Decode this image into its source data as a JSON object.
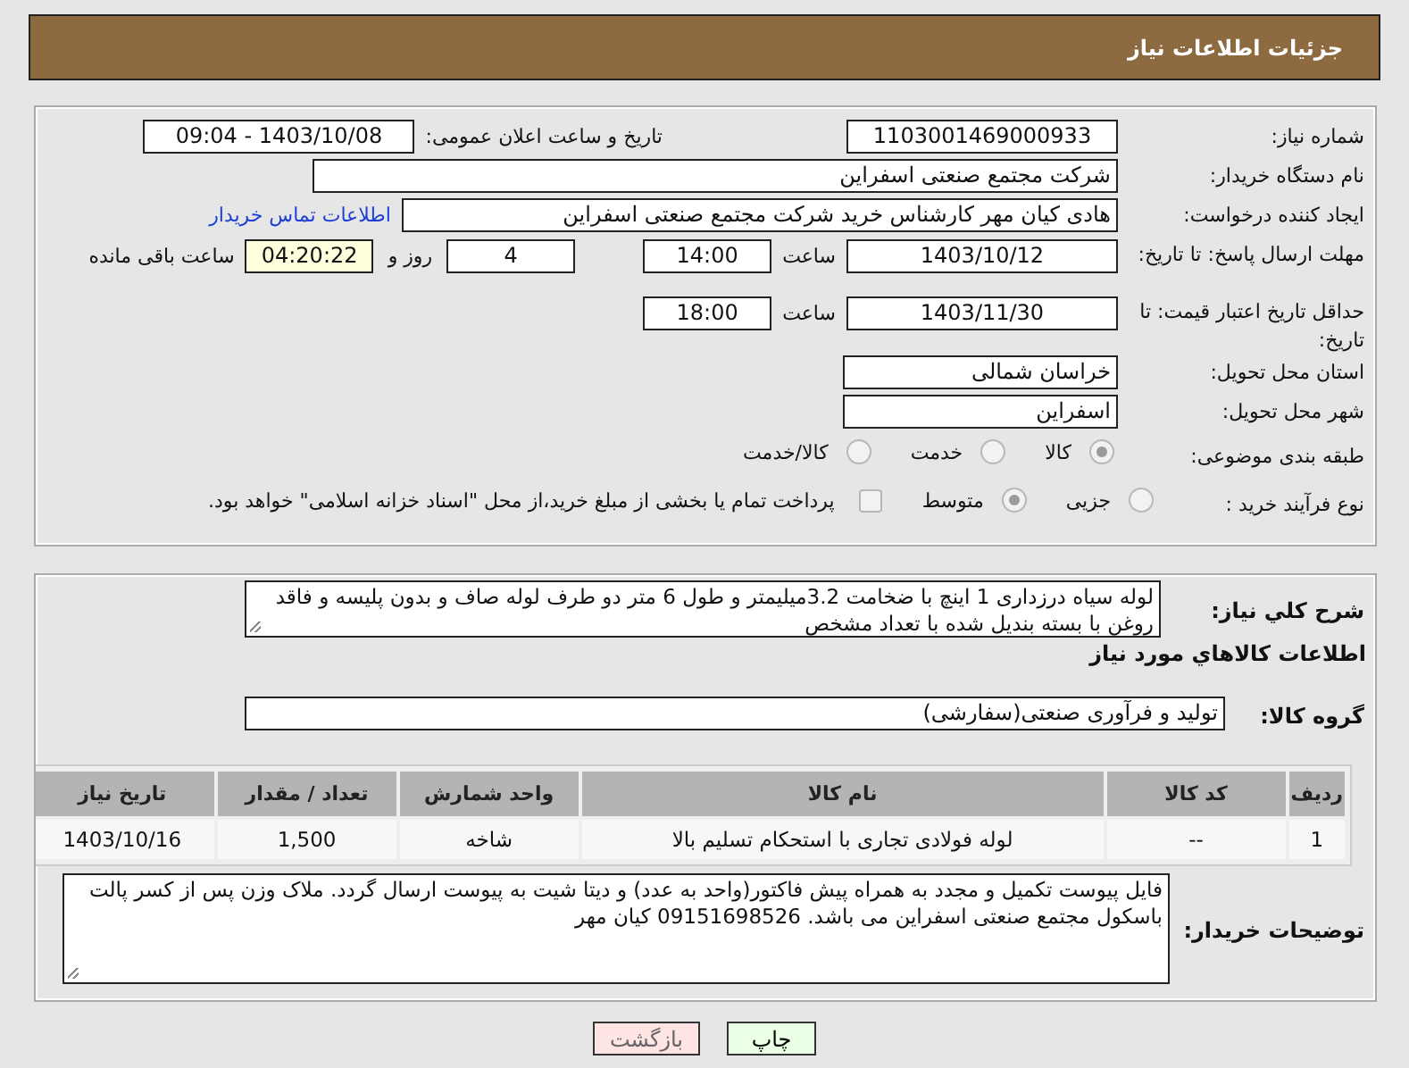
{
  "header": {
    "title": "جزئیات اطلاعات نیاز"
  },
  "details": [
    {
      "label": "شماره نیاز:",
      "items": [
        {
          "kind": "field",
          "value": "1103001469000933"
        },
        {
          "kind": "caption",
          "text": "تاریخ و ساعت اعلان عمومی:"
        },
        {
          "kind": "field",
          "value": "1403/10/08 - 09:04"
        }
      ]
    },
    {
      "label": "نام دستگاه خریدار:",
      "items": [
        {
          "kind": "wide_field",
          "value": "شرکت مجتمع صنعتی اسفراین"
        }
      ]
    },
    {
      "label": "ایجاد کننده درخواست:",
      "items": [
        {
          "kind": "wide_field",
          "value": "هادی کیان مهر کارشناس خرید شرکت مجتمع صنعتی اسفراین"
        },
        {
          "kind": "link",
          "text": "اطلاعات تماس خریدار"
        }
      ]
    },
    {
      "label": "مهلت ارسال پاسخ: تا تاریخ:",
      "items": [
        {
          "kind": "field",
          "value": "1403/10/12"
        },
        {
          "kind": "caption",
          "text": "ساعت"
        },
        {
          "kind": "short_field",
          "value": "14:00"
        },
        {
          "kind": "short_field",
          "value": "4"
        },
        {
          "kind": "caption",
          "text": "روز و"
        },
        {
          "kind": "timer",
          "value": "04:20:22"
        },
        {
          "kind": "caption",
          "text": "ساعت باقی مانده"
        }
      ]
    },
    {
      "label": "حداقل تاریخ اعتبار قیمت: تا تاریخ:",
      "items": [
        {
          "kind": "field",
          "value": "1403/11/30"
        },
        {
          "kind": "caption",
          "text": "ساعت"
        },
        {
          "kind": "short_field",
          "value": "18:00"
        }
      ]
    },
    {
      "label": "استان محل تحویل:",
      "items": [
        {
          "kind": "field",
          "value": "خراسان شمالی"
        }
      ]
    },
    {
      "label": "شهر محل تحویل:",
      "items": [
        {
          "kind": "field",
          "value": "اسفراین"
        }
      ]
    },
    {
      "label": "طبقه بندی موضوعی:",
      "items": [
        {
          "kind": "radio",
          "text": "کالا",
          "selected": true
        },
        {
          "kind": "radio",
          "text": "خدمت",
          "selected": false
        },
        {
          "kind": "radio",
          "text": "کالا/خدمت",
          "selected": false
        }
      ]
    },
    {
      "label": "نوع فرآیند خرید :",
      "items": [
        {
          "kind": "radio",
          "text": "جزیی",
          "selected": false
        },
        {
          "kind": "radio",
          "text": "متوسط",
          "selected": true
        },
        {
          "kind": "checkbox",
          "text": "پرداخت تمام یا بخشی از مبلغ خرید،از محل \"اسناد خزانه اسلامی\" خواهد بود.",
          "checked": false
        }
      ]
    }
  ],
  "description": {
    "label": "شرح کلي نیاز:",
    "value": "لوله سیاه درزداری 1 اینچ با ضخامت 3.2میلیمتر و طول 6 متر دو طرف لوله صاف و بدون پلیسه و فاقد روغن با بسته بندیل شده با تعداد مشخص"
  },
  "goods_heading": "اطلاعات کالاهاي مورد نیاز",
  "goods_group": {
    "label": "گروه کالا:",
    "value": "تولید و فرآوری صنعتی(سفارشی)"
  },
  "table": {
    "columns": [
      "ردیف",
      "کد کالا",
      "نام کالا",
      "واحد شمارش",
      "تعداد / مقدار",
      "تاریخ نیاز"
    ],
    "rows": [
      [
        "1",
        "--",
        "لوله فولادی تجاری با استحکام تسلیم بالا",
        "شاخه",
        "1,500",
        "1403/10/16"
      ]
    ]
  },
  "buyer_notes": {
    "label": "توضیحات خریدار:",
    "value": "فایل پیوست تکمیل و مجدد به همراه پیش فاکتور(واحد به عدد) و دیتا شیت به پیوست ارسال گردد. ملاک وزن پس از کسر پالت باسکول مجتمع صنعتی اسفراین می باشد. 09151698526 کیان مهر"
  },
  "buttons": [
    {
      "label": "چاپ",
      "kind": "print"
    },
    {
      "label": "بازگشت",
      "kind": "back"
    }
  ]
}
